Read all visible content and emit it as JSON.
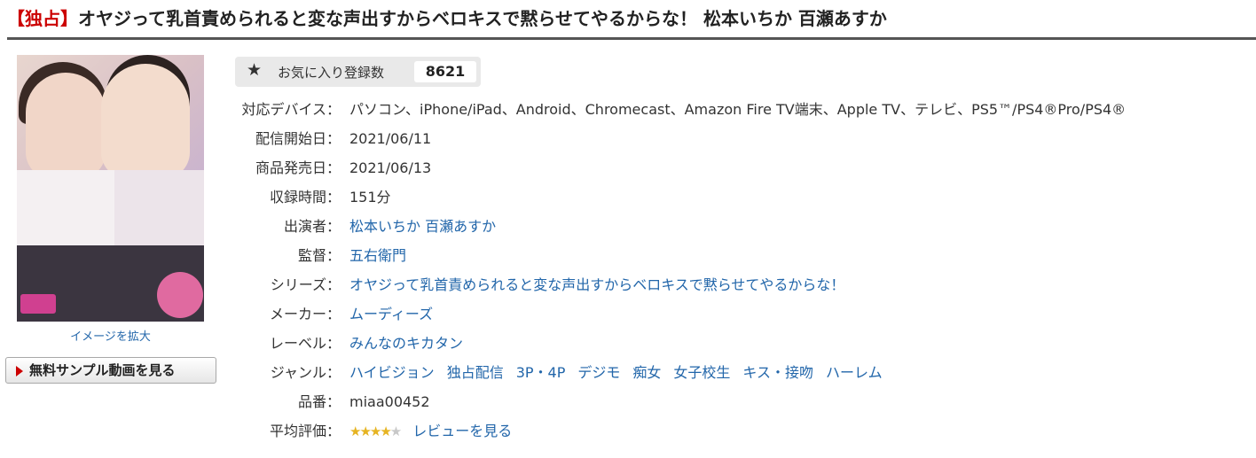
{
  "title": {
    "tag": "【独占】",
    "text": "オヤジって乳首責められると変な声出すからベロキスで黙らせてやるからな！ 松本いちか 百瀬あすか"
  },
  "cover": {
    "enlarge_label": "イメージを拡大"
  },
  "sample_button_label": "無料サンプル動画を見る",
  "favorites": {
    "label": "お気に入り登録数",
    "count": "8621"
  },
  "details": {
    "devices": {
      "label": "対応デバイス：",
      "value": "パソコン、iPhone/iPad、Android、Chromecast、Amazon Fire TV端末、Apple TV、テレビ、PS5™/PS4®Pro/PS4®"
    },
    "stream_start": {
      "label": "配信開始日：",
      "value": "2021/06/11"
    },
    "release_date": {
      "label": "商品発売日：",
      "value": "2021/06/13"
    },
    "duration": {
      "label": "収録時間：",
      "value": "151分"
    },
    "performers": {
      "label": "出演者：",
      "items": [
        "松本いちか",
        "百瀬あすか"
      ]
    },
    "director": {
      "label": "監督：",
      "value": "五右衛門"
    },
    "series": {
      "label": "シリーズ：",
      "value": "オヤジって乳首責められると変な声出すからベロキスで黙らせてやるからな！"
    },
    "maker": {
      "label": "メーカー：",
      "value": "ムーディーズ"
    },
    "label_row": {
      "label": "レーベル：",
      "value": "みんなのキカタン"
    },
    "genre": {
      "label": "ジャンル：",
      "items": [
        "ハイビジョン",
        "独占配信",
        "3P・4P",
        "デジモ",
        "痴女",
        "女子校生",
        "キス・接吻",
        "ハーレム"
      ]
    },
    "product_code": {
      "label": "品番：",
      "value": "miaa00452"
    },
    "rating": {
      "label": "平均評価：",
      "stars": 4.5,
      "review_link": "レビューを見る"
    }
  },
  "colors": {
    "link": "#2266aa",
    "tag": "#cc0000",
    "star": "#e6b422"
  }
}
